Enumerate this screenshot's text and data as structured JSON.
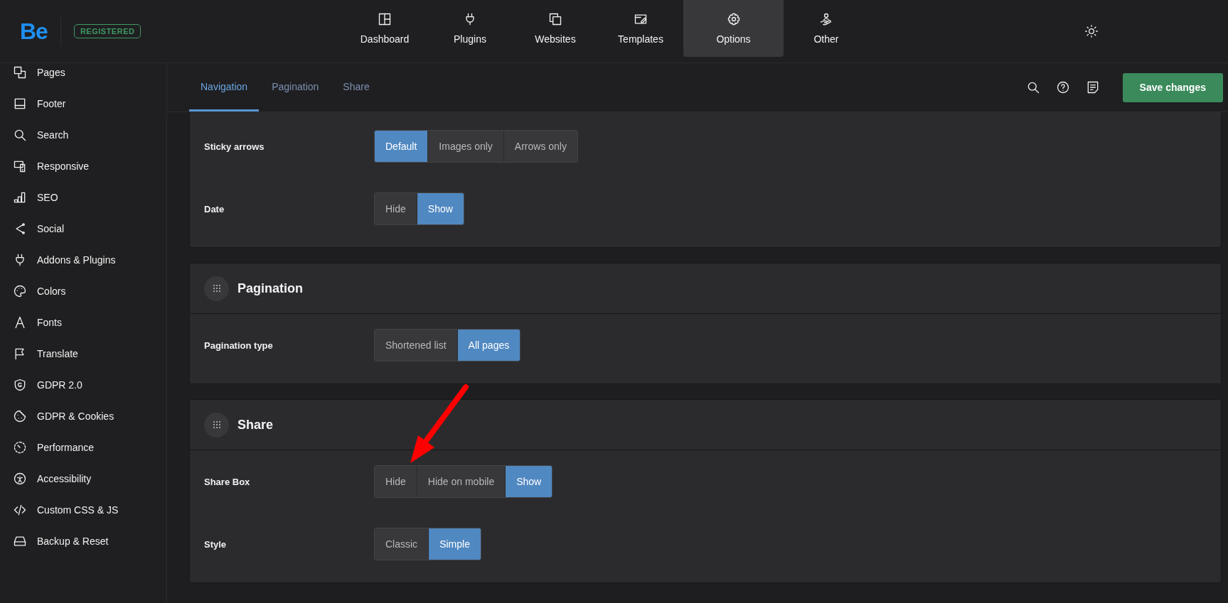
{
  "header": {
    "logo": "Be",
    "badge": "REGISTERED",
    "nav": [
      {
        "label": "Dashboard",
        "selected": false
      },
      {
        "label": "Plugins",
        "selected": false
      },
      {
        "label": "Websites",
        "selected": false
      },
      {
        "label": "Templates",
        "selected": false
      },
      {
        "label": "Options",
        "selected": true
      },
      {
        "label": "Other",
        "selected": false
      }
    ]
  },
  "sidebar": {
    "items": [
      {
        "label": "Pages"
      },
      {
        "label": "Footer"
      },
      {
        "label": "Search"
      },
      {
        "label": "Responsive"
      },
      {
        "label": "SEO"
      },
      {
        "label": "Social"
      },
      {
        "label": "Addons & Plugins"
      },
      {
        "label": "Colors"
      },
      {
        "label": "Fonts"
      },
      {
        "label": "Translate"
      },
      {
        "label": "GDPR 2.0"
      },
      {
        "label": "GDPR & Cookies"
      },
      {
        "label": "Performance"
      },
      {
        "label": "Accessibility"
      },
      {
        "label": "Custom CSS & JS"
      },
      {
        "label": "Backup & Reset"
      }
    ]
  },
  "tabs": [
    {
      "label": "Navigation",
      "selected": true
    },
    {
      "label": "Pagination",
      "selected": false
    },
    {
      "label": "Share",
      "selected": false
    }
  ],
  "toolbar": {
    "save_button": "Save changes"
  },
  "sections": [
    {
      "rows": [
        {
          "label": "Sticky arrows",
          "options": [
            {
              "label": "Default",
              "selected": true
            },
            {
              "label": "Images only",
              "selected": false
            },
            {
              "label": "Arrows only",
              "selected": false
            }
          ]
        },
        {
          "label": "Date",
          "options": [
            {
              "label": "Hide",
              "selected": false
            },
            {
              "label": "Show",
              "selected": true
            }
          ]
        }
      ]
    },
    {
      "title": "Pagination",
      "rows": [
        {
          "label": "Pagination type",
          "options": [
            {
              "label": "Shortened list",
              "selected": false
            },
            {
              "label": "All pages",
              "selected": true
            }
          ]
        }
      ]
    },
    {
      "title": "Share",
      "rows": [
        {
          "label": "Share Box",
          "options": [
            {
              "label": "Hide",
              "selected": false
            },
            {
              "label": "Hide on mobile",
              "selected": false
            },
            {
              "label": "Show",
              "selected": true
            }
          ]
        },
        {
          "label": "Style",
          "options": [
            {
              "label": "Classic",
              "selected": false
            },
            {
              "label": "Simple",
              "selected": true
            }
          ]
        }
      ]
    }
  ]
}
